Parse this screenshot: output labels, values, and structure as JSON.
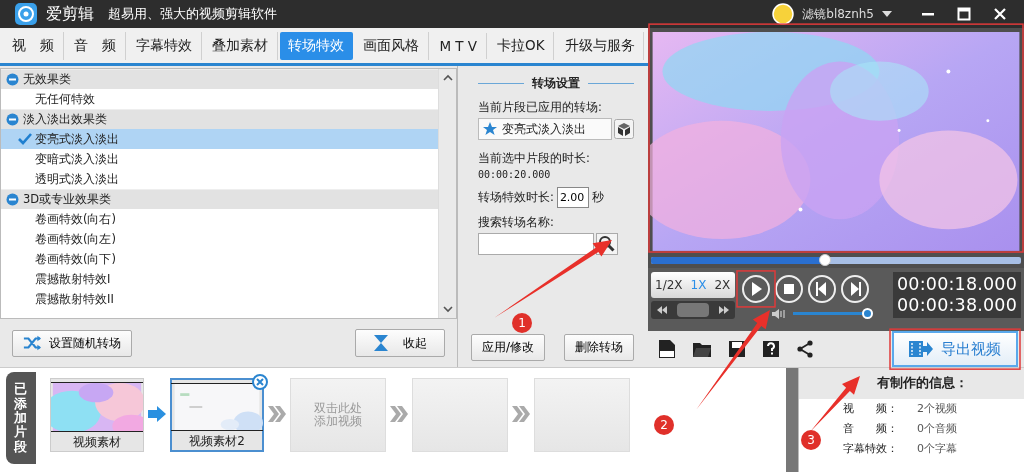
{
  "window": {
    "app_name": "爱剪辑",
    "slogan": "超易用、强大的视频剪辑软件",
    "user": "滤镜bl8znh5"
  },
  "tabs": [
    {
      "label": "视　频",
      "selected": false
    },
    {
      "label": "音　频",
      "selected": false
    },
    {
      "label": "字幕特效",
      "selected": false
    },
    {
      "label": "叠加素材",
      "selected": false
    },
    {
      "label": "转场特效",
      "selected": true
    },
    {
      "label": "画面风格",
      "selected": false
    },
    {
      "label": "M T V",
      "selected": false
    },
    {
      "label": "卡拉OK",
      "selected": false
    },
    {
      "label": "升级与服务",
      "selected": false
    }
  ],
  "effects": [
    {
      "label": "无效果类",
      "expanded": true,
      "children": [
        {
          "label": "无任何特效",
          "selected": false
        }
      ]
    },
    {
      "label": "淡入淡出效果类",
      "expanded": true,
      "children": [
        {
          "label": "变亮式淡入淡出",
          "selected": true
        },
        {
          "label": "变暗式淡入淡出",
          "selected": false
        },
        {
          "label": "透明式淡入淡出",
          "selected": false
        }
      ]
    },
    {
      "label": "3D或专业效果类",
      "expanded": true,
      "children": [
        {
          "label": "卷画特效(向右)",
          "selected": false
        },
        {
          "label": "卷画特效(向左)",
          "selected": false
        },
        {
          "label": "卷画特效(向下)",
          "selected": false
        },
        {
          "label": "震撼散射特效I",
          "selected": false
        },
        {
          "label": "震撼散射特效II",
          "selected": false
        }
      ]
    }
  ],
  "left_buttons": [
    "设置随机转场",
    "收起"
  ],
  "settings": {
    "title": "转场设置",
    "applied_label": "当前片段已应用的转场:",
    "applied_value": "变亮式淡入淡出",
    "duration_label": "当前选中片段的时长:",
    "duration_value": "00:00:20.000",
    "effect_label": "转场特效时长:",
    "effect_value": "2.00",
    "effect_unit": "秒",
    "search_label": "搜索转场名称:",
    "buttons": [
      "应用/修改",
      "删除转场"
    ]
  },
  "player": {
    "progress": {
      "level": 0.47
    },
    "speeds": [
      {
        "label": "1/2X",
        "selected": false
      },
      {
        "label": "1X",
        "selected": true
      },
      {
        "label": "2X",
        "selected": false
      }
    ],
    "volume": {
      "level": 1
    },
    "current_time": "00:00:18.000",
    "total_time": "00:00:38.000",
    "export_button": "导出视频"
  },
  "clips_tab": "已添加片段",
  "clips": [
    {
      "kind": "clip",
      "label": "视频素材",
      "selected": false
    },
    {
      "kind": "arrow"
    },
    {
      "kind": "clip",
      "label": "视频素材2",
      "selected": true
    },
    {
      "kind": "chevron"
    },
    {
      "kind": "empty",
      "lines": [
        "双击此处",
        "添加视频"
      ]
    },
    {
      "kind": "chevron"
    },
    {
      "kind": "empty"
    },
    {
      "kind": "chevron"
    },
    {
      "kind": "empty"
    }
  ],
  "info": {
    "title": "有制作的信息：",
    "rows": [
      {
        "label": "视　　频：",
        "value": "2个视频"
      },
      {
        "label": "音　　频：",
        "value": "0个音频"
      },
      {
        "label": "字幕特效：",
        "value": "0个字幕"
      }
    ]
  },
  "callouts": [
    {
      "label": "1"
    },
    {
      "label": "2"
    },
    {
      "label": "3"
    }
  ]
}
